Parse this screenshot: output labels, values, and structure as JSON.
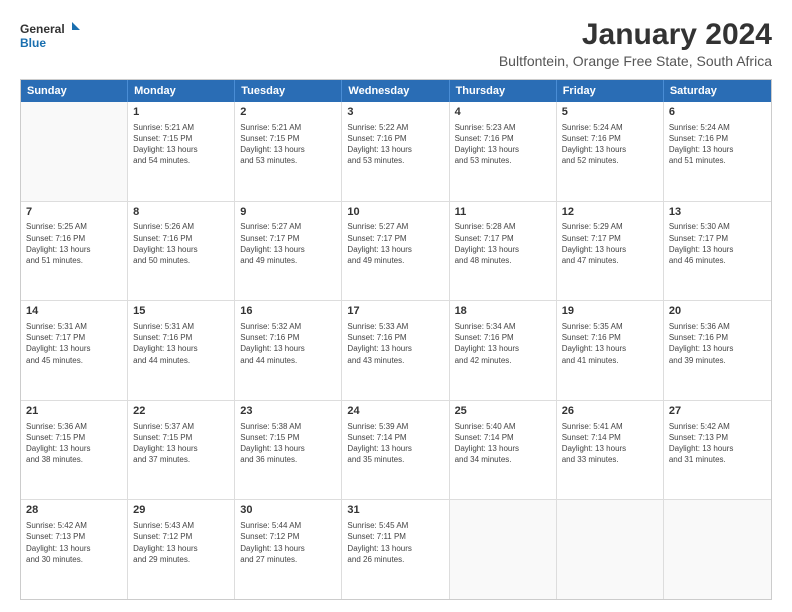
{
  "header": {
    "logo_line1": "General",
    "logo_line2": "Blue",
    "main_title": "January 2024",
    "subtitle": "Bultfontein, Orange Free State, South Africa"
  },
  "days_of_week": [
    "Sunday",
    "Monday",
    "Tuesday",
    "Wednesday",
    "Thursday",
    "Friday",
    "Saturday"
  ],
  "weeks": [
    [
      {
        "day": "",
        "info": ""
      },
      {
        "day": "1",
        "info": "Sunrise: 5:21 AM\nSunset: 7:15 PM\nDaylight: 13 hours\nand 54 minutes."
      },
      {
        "day": "2",
        "info": "Sunrise: 5:21 AM\nSunset: 7:15 PM\nDaylight: 13 hours\nand 53 minutes."
      },
      {
        "day": "3",
        "info": "Sunrise: 5:22 AM\nSunset: 7:16 PM\nDaylight: 13 hours\nand 53 minutes."
      },
      {
        "day": "4",
        "info": "Sunrise: 5:23 AM\nSunset: 7:16 PM\nDaylight: 13 hours\nand 53 minutes."
      },
      {
        "day": "5",
        "info": "Sunrise: 5:24 AM\nSunset: 7:16 PM\nDaylight: 13 hours\nand 52 minutes."
      },
      {
        "day": "6",
        "info": "Sunrise: 5:24 AM\nSunset: 7:16 PM\nDaylight: 13 hours\nand 51 minutes."
      }
    ],
    [
      {
        "day": "7",
        "info": "Sunrise: 5:25 AM\nSunset: 7:16 PM\nDaylight: 13 hours\nand 51 minutes."
      },
      {
        "day": "8",
        "info": "Sunrise: 5:26 AM\nSunset: 7:16 PM\nDaylight: 13 hours\nand 50 minutes."
      },
      {
        "day": "9",
        "info": "Sunrise: 5:27 AM\nSunset: 7:17 PM\nDaylight: 13 hours\nand 49 minutes."
      },
      {
        "day": "10",
        "info": "Sunrise: 5:27 AM\nSunset: 7:17 PM\nDaylight: 13 hours\nand 49 minutes."
      },
      {
        "day": "11",
        "info": "Sunrise: 5:28 AM\nSunset: 7:17 PM\nDaylight: 13 hours\nand 48 minutes."
      },
      {
        "day": "12",
        "info": "Sunrise: 5:29 AM\nSunset: 7:17 PM\nDaylight: 13 hours\nand 47 minutes."
      },
      {
        "day": "13",
        "info": "Sunrise: 5:30 AM\nSunset: 7:17 PM\nDaylight: 13 hours\nand 46 minutes."
      }
    ],
    [
      {
        "day": "14",
        "info": "Sunrise: 5:31 AM\nSunset: 7:17 PM\nDaylight: 13 hours\nand 45 minutes."
      },
      {
        "day": "15",
        "info": "Sunrise: 5:31 AM\nSunset: 7:16 PM\nDaylight: 13 hours\nand 44 minutes."
      },
      {
        "day": "16",
        "info": "Sunrise: 5:32 AM\nSunset: 7:16 PM\nDaylight: 13 hours\nand 44 minutes."
      },
      {
        "day": "17",
        "info": "Sunrise: 5:33 AM\nSunset: 7:16 PM\nDaylight: 13 hours\nand 43 minutes."
      },
      {
        "day": "18",
        "info": "Sunrise: 5:34 AM\nSunset: 7:16 PM\nDaylight: 13 hours\nand 42 minutes."
      },
      {
        "day": "19",
        "info": "Sunrise: 5:35 AM\nSunset: 7:16 PM\nDaylight: 13 hours\nand 41 minutes."
      },
      {
        "day": "20",
        "info": "Sunrise: 5:36 AM\nSunset: 7:16 PM\nDaylight: 13 hours\nand 39 minutes."
      }
    ],
    [
      {
        "day": "21",
        "info": "Sunrise: 5:36 AM\nSunset: 7:15 PM\nDaylight: 13 hours\nand 38 minutes."
      },
      {
        "day": "22",
        "info": "Sunrise: 5:37 AM\nSunset: 7:15 PM\nDaylight: 13 hours\nand 37 minutes."
      },
      {
        "day": "23",
        "info": "Sunrise: 5:38 AM\nSunset: 7:15 PM\nDaylight: 13 hours\nand 36 minutes."
      },
      {
        "day": "24",
        "info": "Sunrise: 5:39 AM\nSunset: 7:14 PM\nDaylight: 13 hours\nand 35 minutes."
      },
      {
        "day": "25",
        "info": "Sunrise: 5:40 AM\nSunset: 7:14 PM\nDaylight: 13 hours\nand 34 minutes."
      },
      {
        "day": "26",
        "info": "Sunrise: 5:41 AM\nSunset: 7:14 PM\nDaylight: 13 hours\nand 33 minutes."
      },
      {
        "day": "27",
        "info": "Sunrise: 5:42 AM\nSunset: 7:13 PM\nDaylight: 13 hours\nand 31 minutes."
      }
    ],
    [
      {
        "day": "28",
        "info": "Sunrise: 5:42 AM\nSunset: 7:13 PM\nDaylight: 13 hours\nand 30 minutes."
      },
      {
        "day": "29",
        "info": "Sunrise: 5:43 AM\nSunset: 7:12 PM\nDaylight: 13 hours\nand 29 minutes."
      },
      {
        "day": "30",
        "info": "Sunrise: 5:44 AM\nSunset: 7:12 PM\nDaylight: 13 hours\nand 27 minutes."
      },
      {
        "day": "31",
        "info": "Sunrise: 5:45 AM\nSunset: 7:11 PM\nDaylight: 13 hours\nand 26 minutes."
      },
      {
        "day": "",
        "info": ""
      },
      {
        "day": "",
        "info": ""
      },
      {
        "day": "",
        "info": ""
      }
    ]
  ]
}
